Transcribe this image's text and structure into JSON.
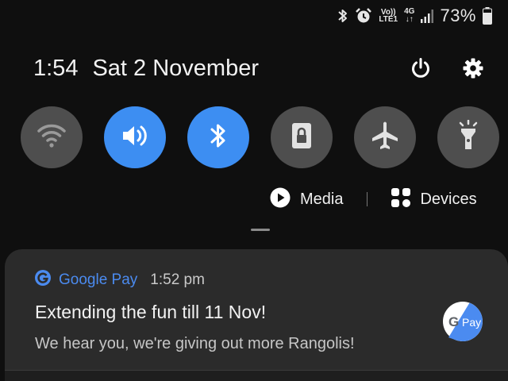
{
  "status_bar": {
    "volte_top": "Vo))",
    "volte_bottom": "LTE1",
    "network_top": "4G",
    "network_bottom": "↓↑",
    "battery_percent": "73%",
    "icons": [
      "bluetooth-icon",
      "alarm-icon",
      "signal-icon",
      "battery-icon"
    ]
  },
  "header": {
    "time": "1:54",
    "date": "Sat 2 November",
    "icons": [
      "power-icon",
      "settings-gear-icon"
    ]
  },
  "quick_toggles": [
    {
      "name": "wifi",
      "icon": "wifi-icon",
      "state": "off"
    },
    {
      "name": "sound",
      "icon": "speaker-icon",
      "state": "on"
    },
    {
      "name": "bluetooth",
      "icon": "bluetooth-icon",
      "state": "on"
    },
    {
      "name": "rotation-lock",
      "icon": "lock-icon",
      "state": "off"
    },
    {
      "name": "airplane-mode",
      "icon": "airplane-icon",
      "state": "off"
    },
    {
      "name": "flashlight",
      "icon": "flashlight-icon",
      "state": "off"
    }
  ],
  "media_row": {
    "media_label": "Media",
    "devices_label": "Devices"
  },
  "notification": {
    "app_name": "Google Pay",
    "time": "1:52 pm",
    "title": "Extending the fun till 11 Nov!",
    "body": "We hear you, we're giving out more Rangolis!",
    "logo_text": "Pay",
    "logo_g": "G"
  },
  "colors": {
    "accent_blue": "#3d8ef2",
    "toggle_off": "#4e4e4e",
    "app_name_blue": "#4b8bf0",
    "card_bg": "#2b2b2b"
  }
}
